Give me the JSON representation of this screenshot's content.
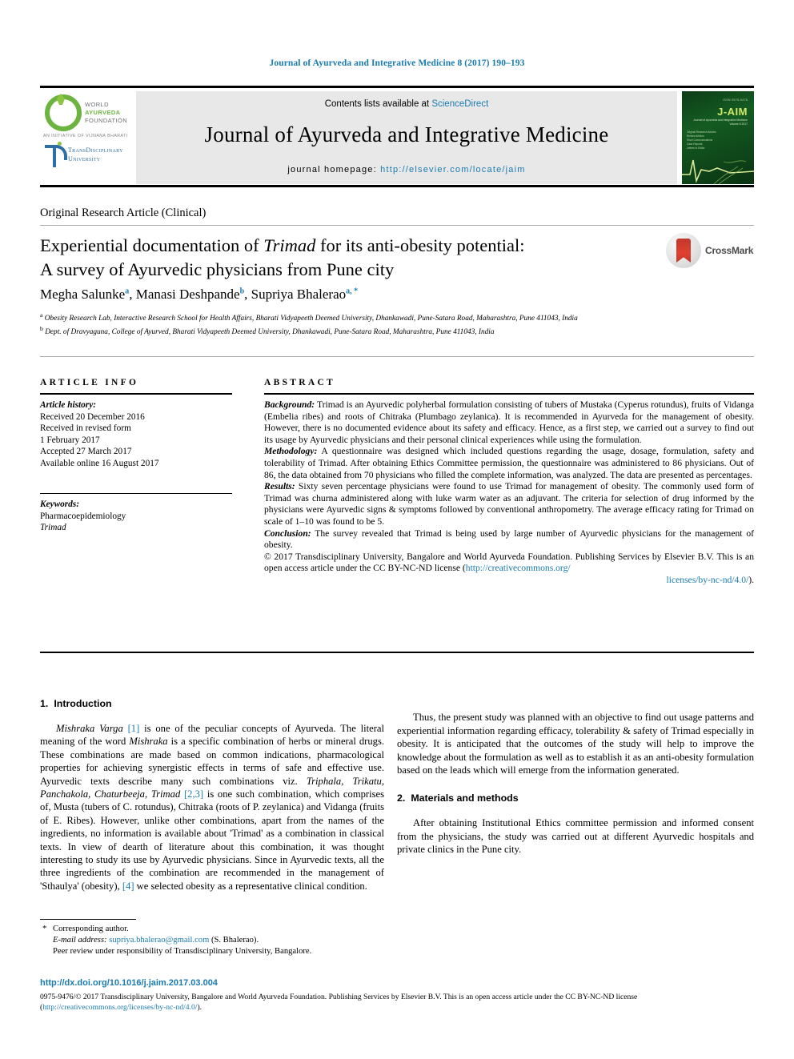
{
  "running_head": "Journal of Ayurveda and Integrative Medicine 8 (2017) 190–193",
  "masthead": {
    "contents_prefix": "Contents lists available at ",
    "contents_link": "ScienceDirect",
    "journal_name": "Journal of Ayurveda and Integrative Medicine",
    "homepage_prefix": "journal homepage: ",
    "homepage_link": "http://elsevier.com/locate/jaim",
    "waf_logo": {
      "line1": "WORLD",
      "line2": "AYURVEDA",
      "line3": "FOUNDATION",
      "initiative": "AN INITIATIVE OF VIJNANA BHARATI",
      "tdu_line1": "TransDisciplinary",
      "tdu_line2": "University"
    },
    "cover": {
      "top_line": "ISSN 0975-9476",
      "title": "J-AIM",
      "sub1": "Journal of Ayurveda and Integrative Medicine",
      "sub2": "Volume 8 2017",
      "items": [
        "Original Research Articles",
        "Review Articles",
        "Short Communications",
        "Case Reports",
        "Letters to Editor"
      ]
    }
  },
  "article": {
    "type": "Original Research Article (Clinical)",
    "title_line1_a": "Experiential documentation of ",
    "title_line1_it": "Trimad",
    "title_line1_b": " for its anti-obesity potential:",
    "title_line2": "A survey of Ayurvedic physicians from Pune city",
    "crossmark_label": "CrossMark",
    "authors": "Megha Salunke , Manasi Deshpande , Supriya Bhalerao",
    "author_list": [
      {
        "name": "Megha Salunke",
        "sup": "a"
      },
      {
        "name": "Manasi Deshpande",
        "sup": "b"
      },
      {
        "name": "Supriya Bhalerao",
        "sup": "a, *"
      }
    ],
    "affiliations": [
      {
        "sup": "a",
        "text": "Obesity Research Lab, Interactive Research School for Health Affairs, Bharati Vidyapeeth Deemed University, Dhankawadi, Pune-Satara Road, Maharashtra, Pune 411043, India"
      },
      {
        "sup": "b",
        "text": "Dept. of Dravyaguna, College of Ayurved, Bharati Vidyapeeth Deemed University, Dhankawadi, Pune-Satara Road, Maharashtra, Pune 411043, India"
      }
    ]
  },
  "article_info": {
    "heading": "ARTICLE INFO",
    "history_label": "Article history:",
    "history": [
      "Received 20 December 2016",
      "Received in revised form",
      "1 February 2017",
      "Accepted 27 March 2017",
      "Available online 16 August 2017"
    ],
    "keywords_label": "Keywords:",
    "keywords": [
      "Pharmacoepidemiology",
      "Trimad"
    ]
  },
  "abstract": {
    "heading": "ABSTRACT",
    "background_label": "Background:",
    "background_text": " Trimad is an Ayurvedic polyherbal formulation consisting of tubers of Mustaka (Cyperus rotundus), fruits of Vidanga (Embelia ribes) and roots of Chitraka (Plumbago zeylanica). It is recommended in Ayurveda for the management of obesity. However, there is no documented evidence about its safety and efficacy. Hence, as a first step, we carried out a survey to find out its usage by Ayurvedic physicians and their personal clinical experiences while using the formulation.",
    "methodology_label": "Methodology:",
    "methodology_text": " A questionnaire was designed which included questions regarding the usage, dosage, formulation, safety and tolerability of Trimad. After obtaining Ethics Committee permission, the questionnaire was administered to 86 physicians. Out of 86, the data obtained from 70 physicians who filled the complete information, was analyzed. The data are presented as percentages.",
    "results_label": "Results:",
    "results_text": " Sixty seven percentage physicians were found to use Trimad for management of obesity. The commonly used form of Trimad was churna administered along with luke warm water as an adjuvant. The criteria for selection of drug informed by the physicians were Ayurvedic signs & symptoms followed by conventional anthropometry. The average efficacy rating for Trimad on scale of 1–10 was found to be 5.",
    "conclusion_label": "Conclusion:",
    "conclusion_text": " The survey revealed that Trimad is being used by large number of Ayurvedic physicians for the management of obesity.",
    "copyright_text": "© 2017 Transdisciplinary University, Bangalore and World Ayurveda Foundation. Publishing Services by Elsevier B.V. This is an open access article under the CC BY-NC-ND license (",
    "copyright_link1": "http://creativecommons.org/",
    "copyright_link2": "licenses/by-nc-nd/4.0/",
    "copyright_tail": ")."
  },
  "sections": {
    "intro": {
      "number": "1.",
      "title": "Introduction",
      "para1_pre": "Mishraka Varga",
      "para1_ref": "[1]",
      "para1_mid": " is one of the peculiar concepts of Ayurveda. The literal meaning of the word ",
      "para1_it2": "Mishraka",
      "para1_mid2": " is a specific combination of herbs or mineral drugs. These combinations are made based on common indications, pharmacological properties for achieving synergistic effects in terms of safe and effective use. Ayurvedic texts describe many such combinations viz. ",
      "para1_it3": "Triphala, Trikatu, Panchakola, Chaturbeeja, Trimad",
      "para1_ref2": "[2,3]",
      "para1_end": " is one such combination, which comprises of, Musta (tubers of C. rotundus), Chitraka (roots of P. zeylanica) and Vidanga (fruits of E. Ribes). However, unlike other combinations, apart from the names of the ingredients, no information is available about 'Trimad' as a combination in classical texts. In view of dearth of literature about this combination, it was thought interesting to study its use by Ayurvedic physicians. Since in Ayurvedic texts, all the three ingredients of the combination are recommended in the management of 'Sthaulya' (obesity), ",
      "para1_ref3": "[4]",
      "para1_tail": " we selected obesity as a representative clinical condition.",
      "para2": "Thus, the present study was planned with an objective to find out usage patterns and experiential information regarding efficacy, tolerability & safety of Trimad especially in obesity. It is anticipated that the outcomes of the study will help to improve the knowledge about the formulation as well as to establish it as an anti-obesity formulation based on the leads which will emerge from the information generated."
    },
    "materials": {
      "number": "2.",
      "title": "Materials and methods",
      "para1": "After obtaining Institutional Ethics committee permission and informed consent from the physicians, the study was carried out at different Ayurvedic hospitals and private clinics in the Pune city."
    }
  },
  "footnote": {
    "star": "*",
    "corresponding": "Corresponding author.",
    "email_label": "E-mail address:",
    "email": "supriya.bhalerao@gmail.com",
    "email_suffix": " (S. Bhalerao).",
    "peer_review": "Peer review under responsibility of Transdisciplinary University, Bangalore."
  },
  "footer": {
    "doi": "http://dx.doi.org/10.1016/j.jaim.2017.03.004",
    "issn_pre": "0975-9476/© 2017 Transdisciplinary University, Bangalore and World Ayurveda Foundation. Publishing Services by Elsevier B.V. This is an open access article under the CC BY-NC-ND license (",
    "issn_link": "http://creativecommons.org/licenses/by-nc-nd/4.0/",
    "issn_tail": ")."
  },
  "colors": {
    "link": "#1a7bb0",
    "waf_green": "#6cb33f",
    "tdu_blue": "#2e6fa7",
    "crossmark_red": "#c0392b"
  }
}
